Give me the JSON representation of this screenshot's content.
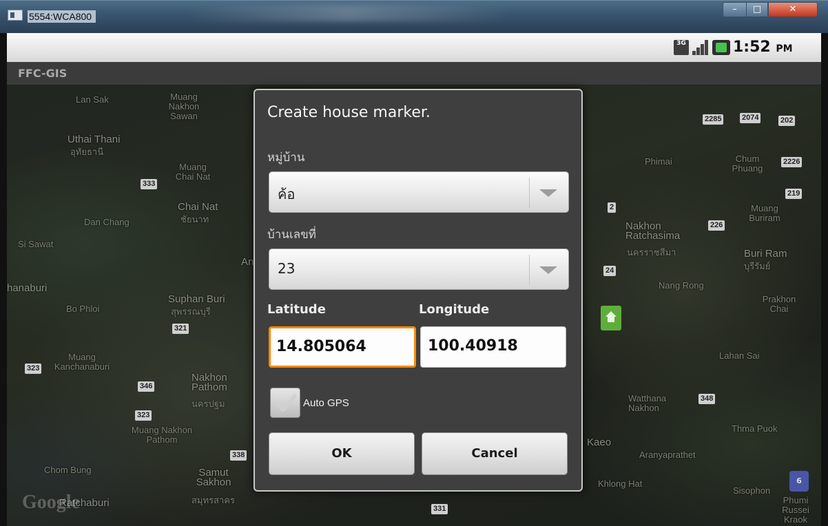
{
  "window": {
    "title": "5554:WCA800",
    "minimize_label": "–",
    "maximize_label": "□",
    "close_label": "✕"
  },
  "status_bar": {
    "network": "3G",
    "time": "1:52",
    "ampm": "PM"
  },
  "app": {
    "title": "FFC-GIS"
  },
  "map": {
    "labels": [
      "Lan Sak",
      "Muang Nakhon Sawan",
      "Uthai Thani",
      "อุทัยธานี",
      "Muang Chai Nat",
      "Chai Nat",
      "ชัยนาท",
      "Dan Chang",
      "Si Sawat",
      "hanaburi",
      "Bo Phloi",
      "Suphan Buri",
      "สุพรรณบุรี",
      "Muang Kanchanaburi",
      "Nakhon Pathom",
      "นครปฐม",
      "Muang Nakhon Pathom",
      "Chom Bung",
      "Samut Sakhon",
      "สมุทรสาคร",
      "Ratchaburi",
      "Phimai",
      "Chum Phuang",
      "Nakhon Ratchasima",
      "นครราชสีมา",
      "Nang Rong",
      "Buri Ram",
      "บุรีรัมย์",
      "Muang Buriram",
      "Prakhon Chai",
      "Lahan Sai",
      "Watthana Nakhon",
      "Kaeo",
      "Aranyaprathet",
      "Khlong Hat",
      "Thma Puok",
      "Sisophon",
      "Phumi Russei Kraok",
      "Ang"
    ],
    "shields": [
      "333",
      "321",
      "323",
      "346",
      "323",
      "338",
      "331",
      "2285",
      "2074",
      "202",
      "2226",
      "219",
      "2",
      "226",
      "24",
      "348"
    ],
    "watermark": "Google"
  },
  "dialog": {
    "title": "Create house marker.",
    "village_label": "หมู่บ้าน",
    "village_value": "ค้อ",
    "house_no_label": "บ้านเลขที่",
    "house_no_value": "23",
    "latitude_label": "Latitude",
    "latitude_value": "14.805064",
    "longitude_label": "Longitude",
    "longitude_value": "100.40918",
    "auto_gps_label": "Auto GPS",
    "auto_gps_checked": true,
    "ok_label": "OK",
    "cancel_label": "Cancel"
  },
  "colors": {
    "focus_accent": "#ff8a00",
    "dialog_bg": "#3f3f3f"
  }
}
